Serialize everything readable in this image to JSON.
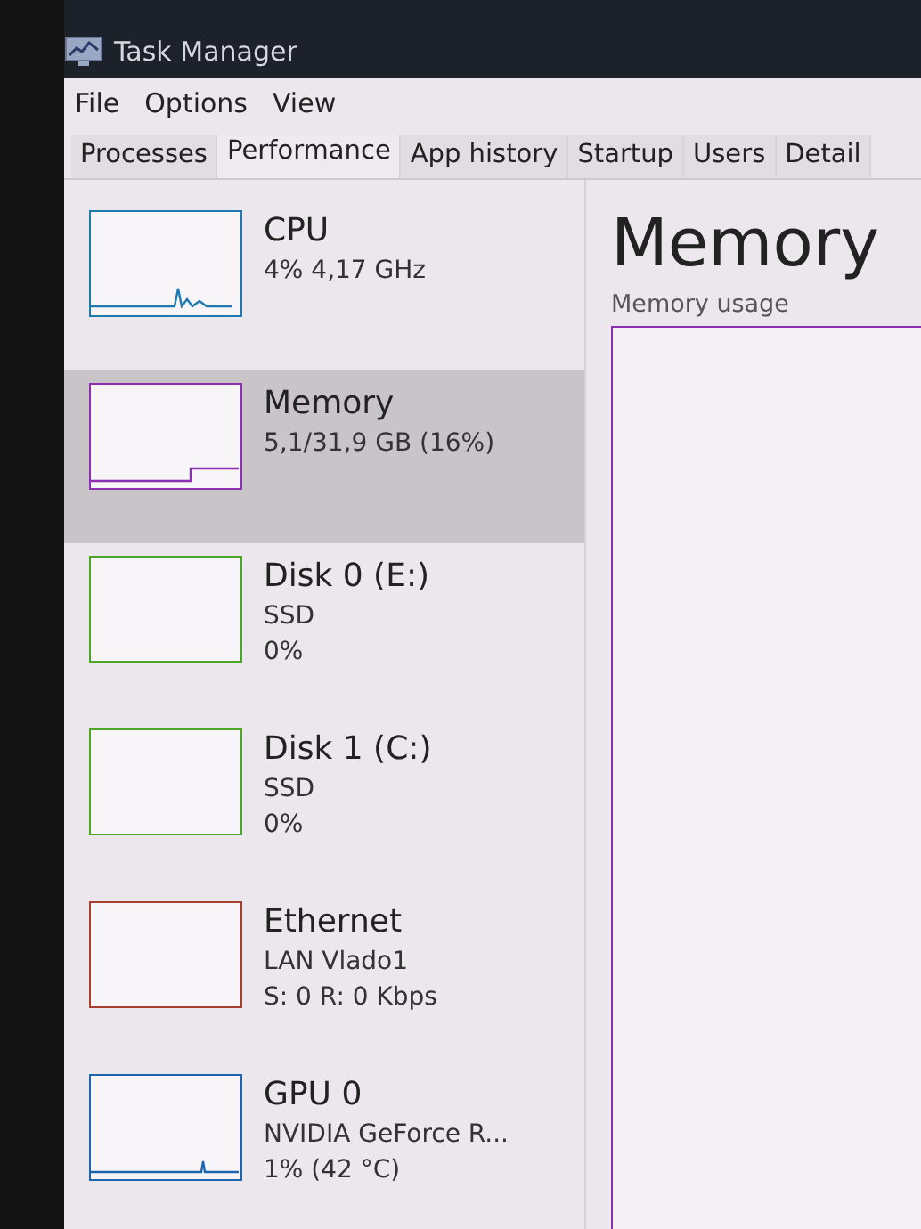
{
  "window": {
    "title": "Task Manager"
  },
  "menu": [
    "File",
    "Options",
    "View"
  ],
  "tabs": [
    {
      "label": "Processes",
      "selected": false
    },
    {
      "label": "Performance",
      "selected": true
    },
    {
      "label": "App history",
      "selected": false
    },
    {
      "label": "Startup",
      "selected": false
    },
    {
      "label": "Users",
      "selected": false
    },
    {
      "label": "Detail",
      "selected": false
    }
  ],
  "sidebar": {
    "items": [
      {
        "kind": "cpu",
        "name": "CPU",
        "details": [
          "4% 4,17 GHz"
        ],
        "color": "#1c7ab0",
        "selected": false
      },
      {
        "kind": "memory",
        "name": "Memory",
        "details": [
          "5,1/31,9 GB (16%)"
        ],
        "color": "#8b2fb0",
        "selected": true
      },
      {
        "kind": "disk",
        "name": "Disk 0 (E:)",
        "details": [
          "SSD",
          "0%"
        ],
        "color": "#4da628",
        "selected": false
      },
      {
        "kind": "disk",
        "name": "Disk 1 (C:)",
        "details": [
          "SSD",
          "0%"
        ],
        "color": "#4da628",
        "selected": false
      },
      {
        "kind": "network",
        "name": "Ethernet",
        "details": [
          "LAN Vlado1",
          "S: 0 R: 0 Kbps"
        ],
        "color": "#a7402c",
        "selected": false
      },
      {
        "kind": "gpu",
        "name": "GPU 0",
        "details": [
          "NVIDIA GeForce R...",
          "1% (42 °C)"
        ],
        "color": "#1c66b0",
        "selected": false
      }
    ]
  },
  "detail": {
    "title": "Memory",
    "graph_label": "Memory usage",
    "color": "#8b2fb0"
  }
}
